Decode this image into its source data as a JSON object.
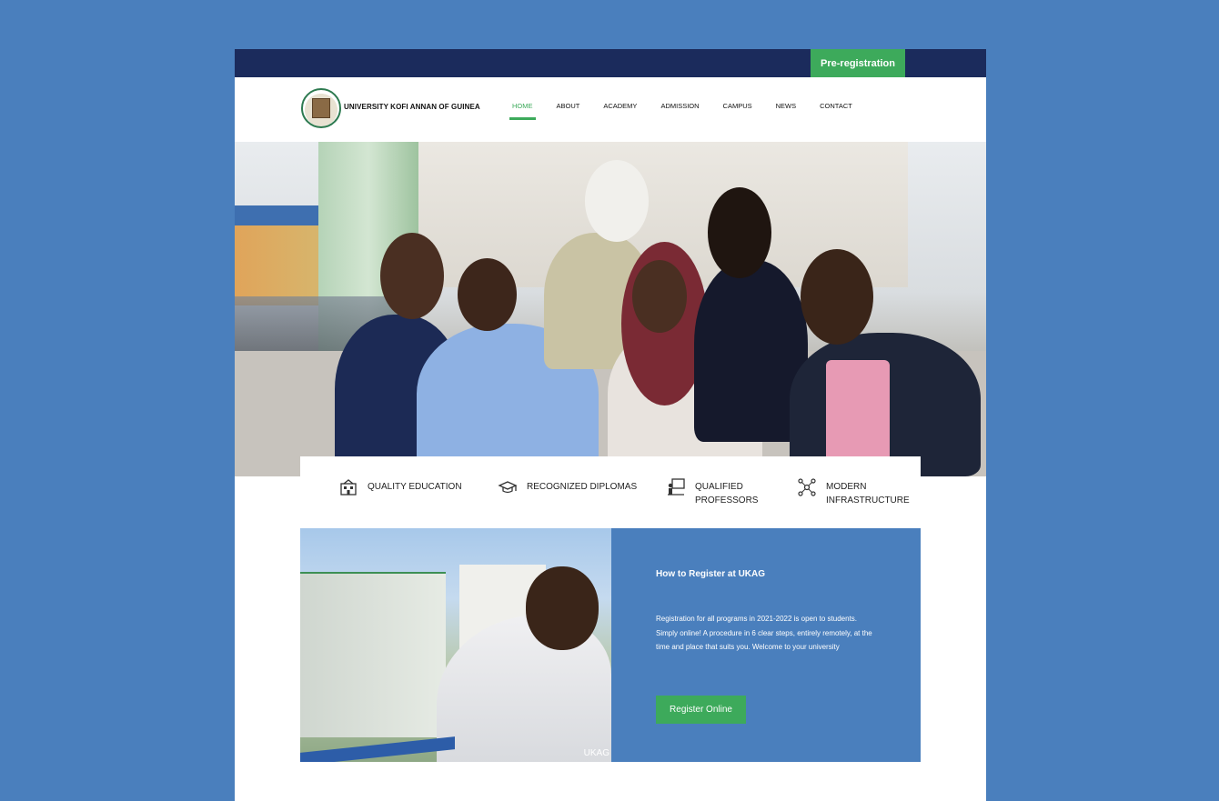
{
  "colors": {
    "background": "#4a7fbd",
    "topbar": "#1b2b5c",
    "accent_green": "#3daa5b",
    "panel_blue": "#4a7fbd"
  },
  "topbar": {
    "prereg_label": "Pre-registration"
  },
  "header": {
    "brand": "UNIVERSITY KOFI ANNAN OF GUINEA",
    "nav": [
      "HOME",
      "ABOUT",
      "ACADEMY",
      "ADMISSION",
      "CAMPUS",
      "NEWS",
      "CONTACT"
    ],
    "active_nav": "HOME"
  },
  "features": [
    {
      "icon": "school-building-icon",
      "label": "QUALITY EDUCATION"
    },
    {
      "icon": "graduation-cap-icon",
      "label": "RECOGNIZED DIPLOMAS"
    },
    {
      "icon": "teacher-board-icon",
      "label": "QUALIFIED PROFESSORS"
    },
    {
      "icon": "network-nodes-icon",
      "label": "MODERN INFRASTRUCTURE"
    }
  ],
  "register": {
    "title": "How to Register at UKAG",
    "text": "Registration for all programs in 2021-2022 is open to students. Simply online! A procedure in 6 clear steps, entirely remotely, at the time and place that suits you. Welcome to your university",
    "button": "Register Online",
    "image_caption": "UKAG"
  }
}
